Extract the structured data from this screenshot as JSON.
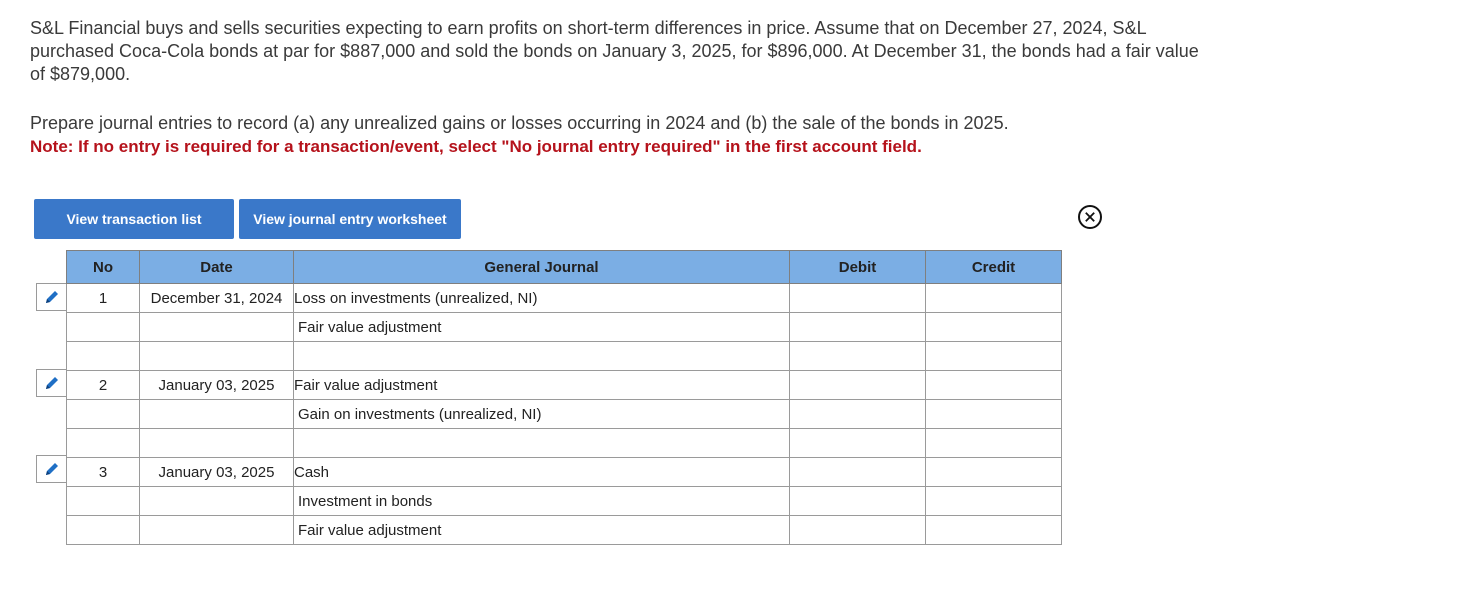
{
  "problem": {
    "text": "S&L Financial buys and sells securities expecting to earn profits on short-term differences in price. Assume that on December 27, 2024, S&L purchased Coca-Cola bonds at par for $887,000 and sold the bonds on January 3, 2025, for $896,000. At December 31, the bonds had a fair value of $879,000."
  },
  "instructions": {
    "text": "Prepare journal entries to record (a) any unrealized gains or losses occurring in 2024 and (b) the sale of the bonds in 2025.",
    "note": "Note: If no entry is required for a transaction/event, select \"No journal entry required\" in the first account field."
  },
  "buttons": {
    "view_transaction_list": "View transaction list",
    "view_journal_entry_worksheet": "View journal entry worksheet"
  },
  "icons": {
    "close": "close-circle-icon",
    "edit": "pencil-icon"
  },
  "colors": {
    "button_bg": "#3a78c9",
    "header_bg": "#7baee4",
    "note_red": "#b5121b",
    "pencil_blue": "#1f6fc5"
  },
  "journal": {
    "headers": {
      "no": "No",
      "date": "Date",
      "general_journal": "General Journal",
      "debit": "Debit",
      "credit": "Credit"
    },
    "rows": [
      {
        "no": "1",
        "date": "December 31, 2024",
        "account": "Loss on investments (unrealized, NI)",
        "debit": "",
        "credit": ""
      },
      {
        "no": "",
        "date": "",
        "account": "Fair value adjustment",
        "debit": "",
        "credit": ""
      },
      {
        "no": "",
        "date": "",
        "account": "",
        "debit": "",
        "credit": ""
      },
      {
        "no": "2",
        "date": "January 03, 2025",
        "account": "Fair value adjustment",
        "debit": "",
        "credit": ""
      },
      {
        "no": "",
        "date": "",
        "account": "Gain on investments (unrealized, NI)",
        "debit": "",
        "credit": ""
      },
      {
        "no": "",
        "date": "",
        "account": "",
        "debit": "",
        "credit": ""
      },
      {
        "no": "3",
        "date": "January 03, 2025",
        "account": "Cash",
        "debit": "",
        "credit": ""
      },
      {
        "no": "",
        "date": "",
        "account": "Investment in bonds",
        "debit": "",
        "credit": ""
      },
      {
        "no": "",
        "date": "",
        "account": "Fair value adjustment",
        "debit": "",
        "credit": ""
      }
    ]
  }
}
